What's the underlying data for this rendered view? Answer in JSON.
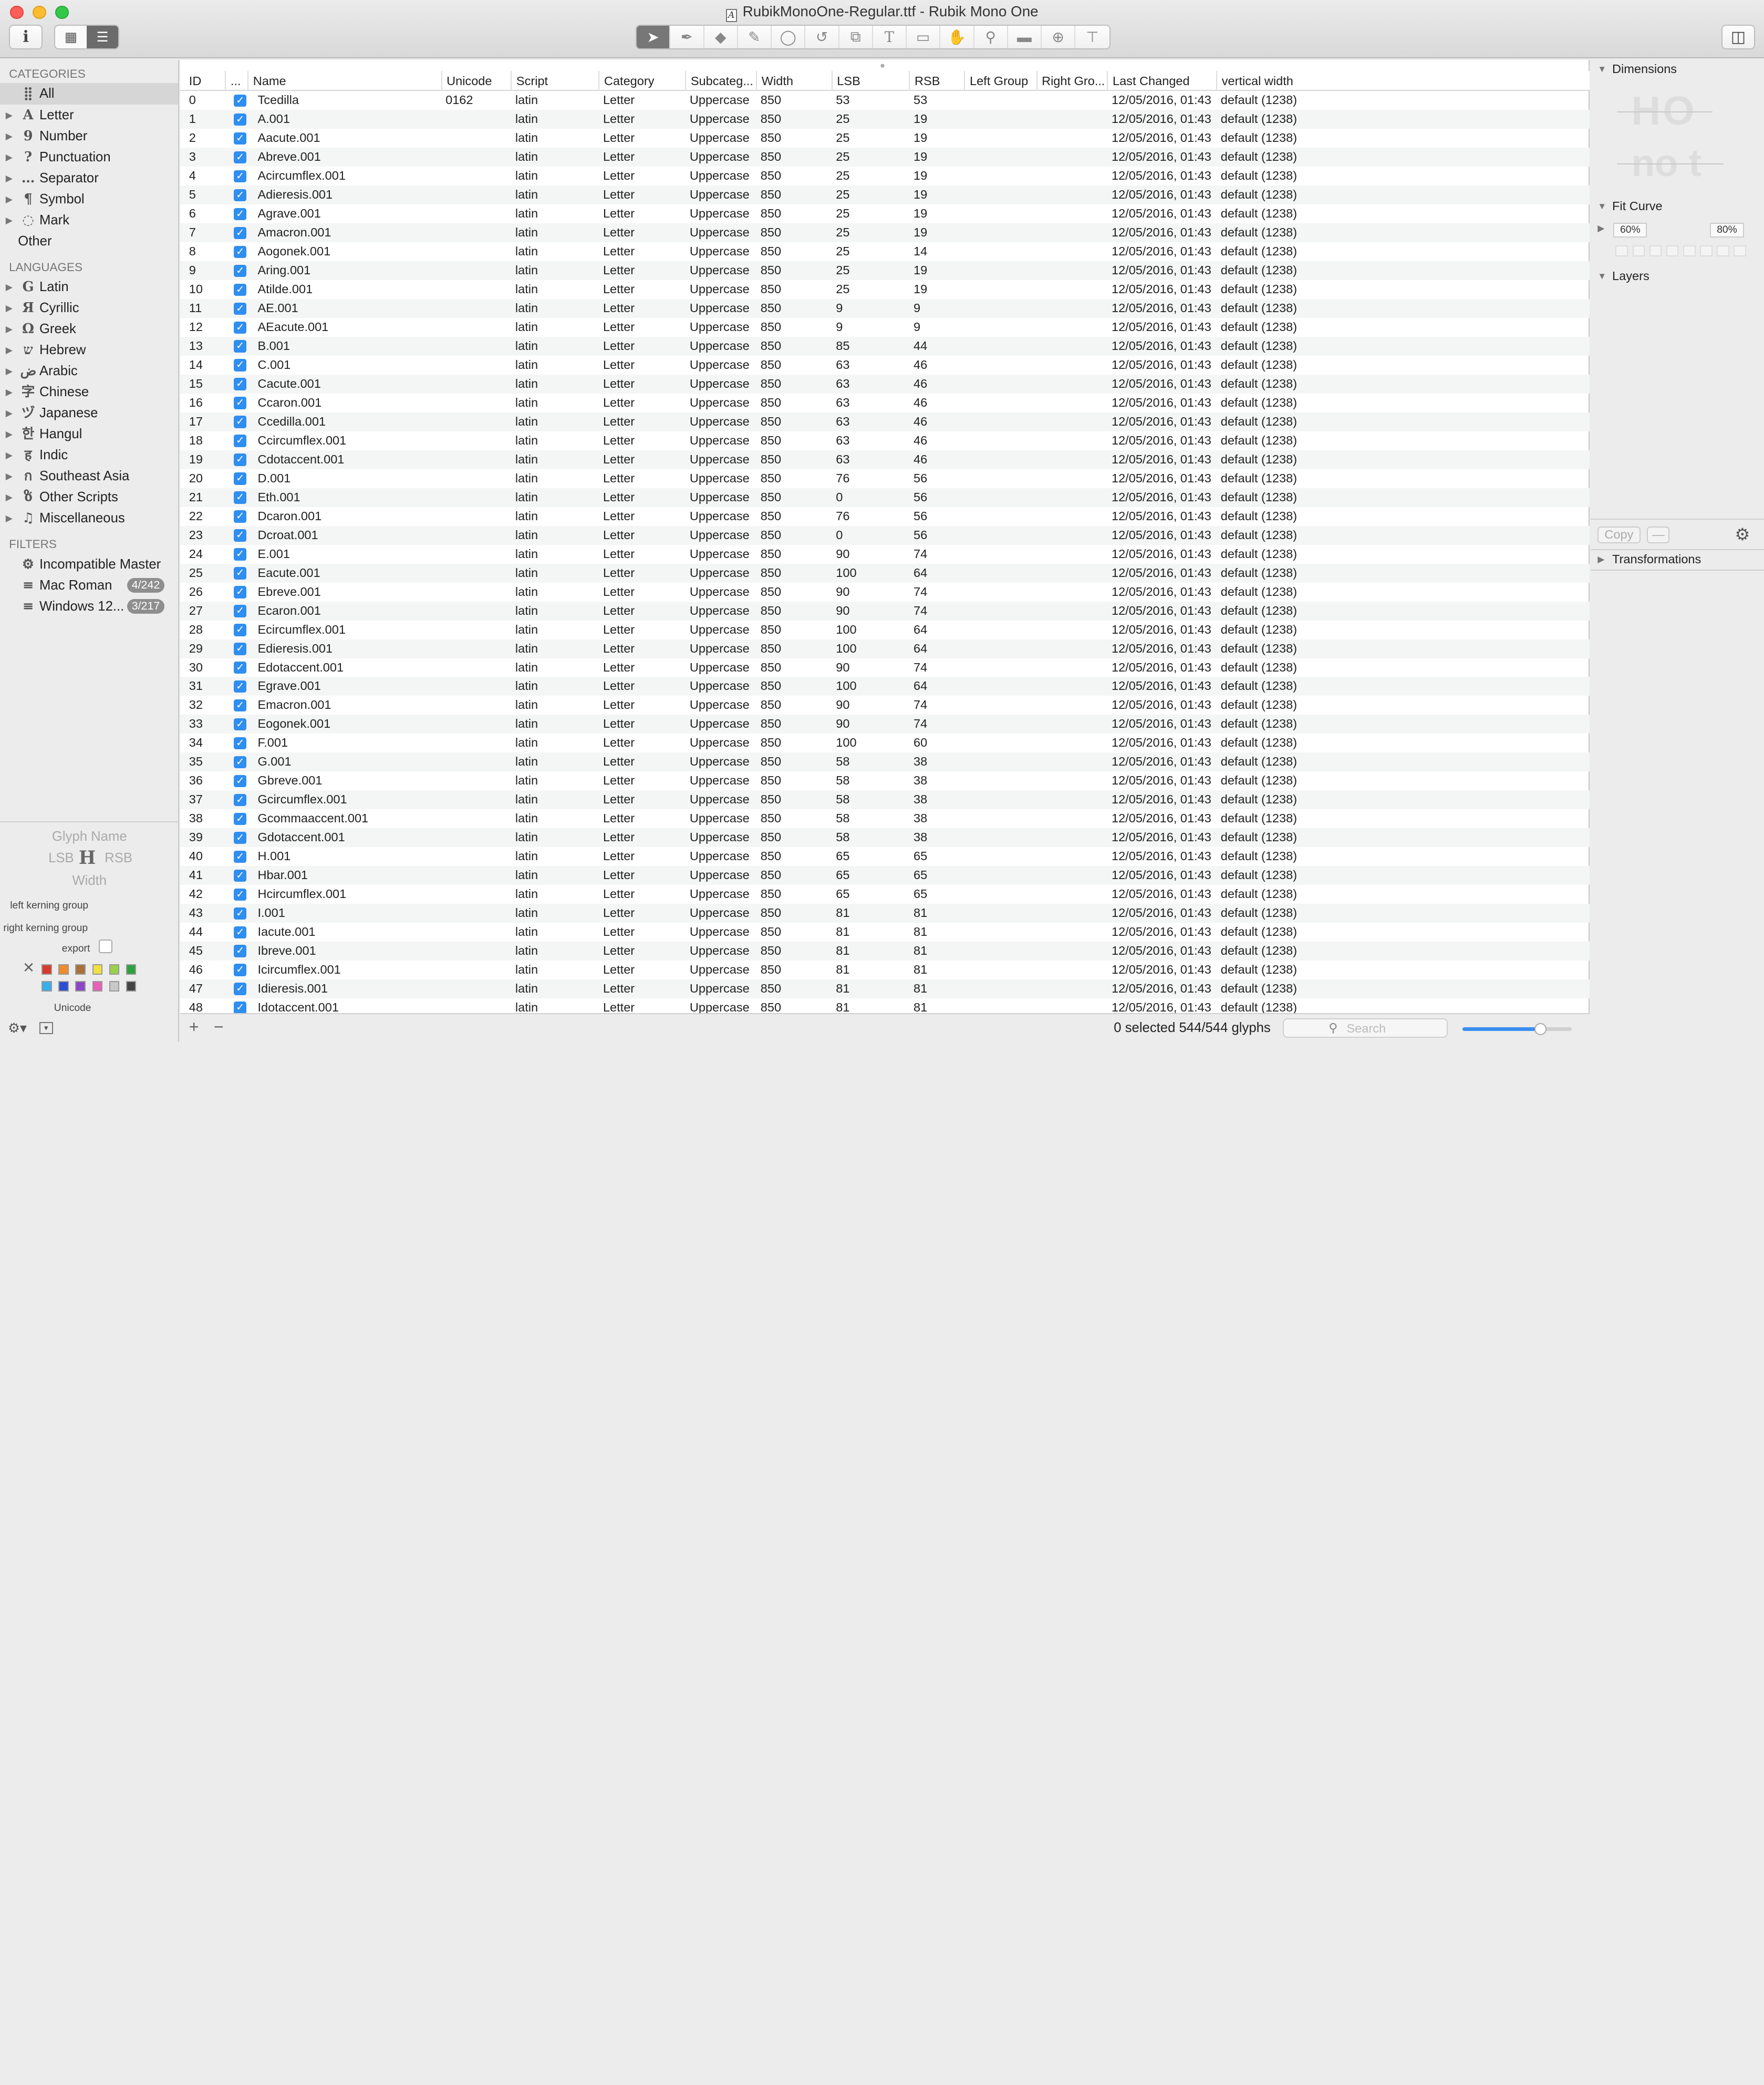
{
  "window": {
    "title": "RubikMonoOne-Regular.ttf - Rubik Mono One",
    "file_icon": "A"
  },
  "toolbar": {
    "info_label": "i",
    "view_grid_icon": "grid-view-icon",
    "view_list_icon": "list-view-icon",
    "tools": [
      "select-tool-icon",
      "select-all-layers-icon",
      "draw-tool-icon",
      "pencil-tool-icon",
      "primitives-tool-icon",
      "rotate-tool-icon",
      "scale-tool-icon",
      "text-tool-icon",
      "annotation-tool-icon",
      "hand-tool-icon",
      "zoom-tool-icon",
      "measurement-tool-icon",
      "knife-tool-icon",
      "anchor-tool-icon"
    ]
  },
  "sidebar": {
    "categories_header": "CATEGORIES",
    "categories": [
      {
        "label": "All",
        "glyph": "⣿",
        "expandable": false,
        "selected": true
      },
      {
        "label": "Letter",
        "glyph": "A",
        "expandable": true
      },
      {
        "label": "Number",
        "glyph": "9",
        "expandable": true
      },
      {
        "label": "Punctuation",
        "glyph": "?",
        "expandable": true
      },
      {
        "label": "Separator",
        "glyph": "…",
        "expandable": true
      },
      {
        "label": "Symbol",
        "glyph": "¶",
        "expandable": true
      },
      {
        "label": "Mark",
        "glyph": "◌",
        "expandable": true
      },
      {
        "label": "Other",
        "glyph": "",
        "expandable": false
      }
    ],
    "languages_header": "LANGUAGES",
    "languages": [
      {
        "label": "Latin",
        "glyph": "G"
      },
      {
        "label": "Cyrillic",
        "glyph": "Я"
      },
      {
        "label": "Greek",
        "glyph": "Ω"
      },
      {
        "label": "Hebrew",
        "glyph": "ש"
      },
      {
        "label": "Arabic",
        "glyph": "ض"
      },
      {
        "label": "Chinese",
        "glyph": "字"
      },
      {
        "label": "Japanese",
        "glyph": "ヅ"
      },
      {
        "label": "Hangul",
        "glyph": "한"
      },
      {
        "label": "Indic",
        "glyph": "ह"
      },
      {
        "label": "Southeast Asia",
        "glyph": "ก"
      },
      {
        "label": "Other Scripts",
        "glyph": "ზ"
      },
      {
        "label": "Miscellaneous",
        "glyph": "♫"
      }
    ],
    "filters_header": "FILTERS",
    "filters": [
      {
        "label": "Incompatible Master",
        "glyph": "⚙",
        "badge": ""
      },
      {
        "label": "Mac Roman",
        "glyph": "≡",
        "badge": "4/242"
      },
      {
        "label": "Windows 12...",
        "glyph": "≡",
        "badge": "3/217"
      }
    ],
    "glyph_info": {
      "name_placeholder": "Glyph Name",
      "lsb": "LSB",
      "rsb": "RSB",
      "width": "Width",
      "left_kerning": "left kerning group",
      "right_kerning": "right kerning group",
      "export_label": "export",
      "unicode_label": "Unicode",
      "colors": [
        "#d93a2e",
        "#f08c2a",
        "#a8713a",
        "#f0e040",
        "#9ad04c",
        "#2ea23c",
        "#3aaee8",
        "#2c4fd0",
        "#8a48c8",
        "#e860b8",
        "#c8c8c8",
        "#444444"
      ]
    }
  },
  "table": {
    "columns": [
      "ID",
      "...",
      "Name",
      "Unicode",
      "Script",
      "Category",
      "Subcateg...",
      "Width",
      "LSB",
      "RSB",
      "Left Group",
      "Right Gro...",
      "Last Changed",
      "vertical width"
    ],
    "rows": [
      [
        "0",
        "Tcedilla",
        "0162",
        "latin",
        "Letter",
        "Uppercase",
        "850",
        "53",
        "53",
        "12/05/2016, 01:43",
        "default (1238)"
      ],
      [
        "1",
        "A.001",
        "",
        "latin",
        "Letter",
        "Uppercase",
        "850",
        "25",
        "19",
        "12/05/2016, 01:43",
        "default (1238)"
      ],
      [
        "2",
        "Aacute.001",
        "",
        "latin",
        "Letter",
        "Uppercase",
        "850",
        "25",
        "19",
        "12/05/2016, 01:43",
        "default (1238)"
      ],
      [
        "3",
        "Abreve.001",
        "",
        "latin",
        "Letter",
        "Uppercase",
        "850",
        "25",
        "19",
        "12/05/2016, 01:43",
        "default (1238)"
      ],
      [
        "4",
        "Acircumflex.001",
        "",
        "latin",
        "Letter",
        "Uppercase",
        "850",
        "25",
        "19",
        "12/05/2016, 01:43",
        "default (1238)"
      ],
      [
        "5",
        "Adieresis.001",
        "",
        "latin",
        "Letter",
        "Uppercase",
        "850",
        "25",
        "19",
        "12/05/2016, 01:43",
        "default (1238)"
      ],
      [
        "6",
        "Agrave.001",
        "",
        "latin",
        "Letter",
        "Uppercase",
        "850",
        "25",
        "19",
        "12/05/2016, 01:43",
        "default (1238)"
      ],
      [
        "7",
        "Amacron.001",
        "",
        "latin",
        "Letter",
        "Uppercase",
        "850",
        "25",
        "19",
        "12/05/2016, 01:43",
        "default (1238)"
      ],
      [
        "8",
        "Aogonek.001",
        "",
        "latin",
        "Letter",
        "Uppercase",
        "850",
        "25",
        "14",
        "12/05/2016, 01:43",
        "default (1238)"
      ],
      [
        "9",
        "Aring.001",
        "",
        "latin",
        "Letter",
        "Uppercase",
        "850",
        "25",
        "19",
        "12/05/2016, 01:43",
        "default (1238)"
      ],
      [
        "10",
        "Atilde.001",
        "",
        "latin",
        "Letter",
        "Uppercase",
        "850",
        "25",
        "19",
        "12/05/2016, 01:43",
        "default (1238)"
      ],
      [
        "11",
        "AE.001",
        "",
        "latin",
        "Letter",
        "Uppercase",
        "850",
        "9",
        "9",
        "12/05/2016, 01:43",
        "default (1238)"
      ],
      [
        "12",
        "AEacute.001",
        "",
        "latin",
        "Letter",
        "Uppercase",
        "850",
        "9",
        "9",
        "12/05/2016, 01:43",
        "default (1238)"
      ],
      [
        "13",
        "B.001",
        "",
        "latin",
        "Letter",
        "Uppercase",
        "850",
        "85",
        "44",
        "12/05/2016, 01:43",
        "default (1238)"
      ],
      [
        "14",
        "C.001",
        "",
        "latin",
        "Letter",
        "Uppercase",
        "850",
        "63",
        "46",
        "12/05/2016, 01:43",
        "default (1238)"
      ],
      [
        "15",
        "Cacute.001",
        "",
        "latin",
        "Letter",
        "Uppercase",
        "850",
        "63",
        "46",
        "12/05/2016, 01:43",
        "default (1238)"
      ],
      [
        "16",
        "Ccaron.001",
        "",
        "latin",
        "Letter",
        "Uppercase",
        "850",
        "63",
        "46",
        "12/05/2016, 01:43",
        "default (1238)"
      ],
      [
        "17",
        "Ccedilla.001",
        "",
        "latin",
        "Letter",
        "Uppercase",
        "850",
        "63",
        "46",
        "12/05/2016, 01:43",
        "default (1238)"
      ],
      [
        "18",
        "Ccircumflex.001",
        "",
        "latin",
        "Letter",
        "Uppercase",
        "850",
        "63",
        "46",
        "12/05/2016, 01:43",
        "default (1238)"
      ],
      [
        "19",
        "Cdotaccent.001",
        "",
        "latin",
        "Letter",
        "Uppercase",
        "850",
        "63",
        "46",
        "12/05/2016, 01:43",
        "default (1238)"
      ],
      [
        "20",
        "D.001",
        "",
        "latin",
        "Letter",
        "Uppercase",
        "850",
        "76",
        "56",
        "12/05/2016, 01:43",
        "default (1238)"
      ],
      [
        "21",
        "Eth.001",
        "",
        "latin",
        "Letter",
        "Uppercase",
        "850",
        "0",
        "56",
        "12/05/2016, 01:43",
        "default (1238)"
      ],
      [
        "22",
        "Dcaron.001",
        "",
        "latin",
        "Letter",
        "Uppercase",
        "850",
        "76",
        "56",
        "12/05/2016, 01:43",
        "default (1238)"
      ],
      [
        "23",
        "Dcroat.001",
        "",
        "latin",
        "Letter",
        "Uppercase",
        "850",
        "0",
        "56",
        "12/05/2016, 01:43",
        "default (1238)"
      ],
      [
        "24",
        "E.001",
        "",
        "latin",
        "Letter",
        "Uppercase",
        "850",
        "90",
        "74",
        "12/05/2016, 01:43",
        "default (1238)"
      ],
      [
        "25",
        "Eacute.001",
        "",
        "latin",
        "Letter",
        "Uppercase",
        "850",
        "100",
        "64",
        "12/05/2016, 01:43",
        "default (1238)"
      ],
      [
        "26",
        "Ebreve.001",
        "",
        "latin",
        "Letter",
        "Uppercase",
        "850",
        "90",
        "74",
        "12/05/2016, 01:43",
        "default (1238)"
      ],
      [
        "27",
        "Ecaron.001",
        "",
        "latin",
        "Letter",
        "Uppercase",
        "850",
        "90",
        "74",
        "12/05/2016, 01:43",
        "default (1238)"
      ],
      [
        "28",
        "Ecircumflex.001",
        "",
        "latin",
        "Letter",
        "Uppercase",
        "850",
        "100",
        "64",
        "12/05/2016, 01:43",
        "default (1238)"
      ],
      [
        "29",
        "Edieresis.001",
        "",
        "latin",
        "Letter",
        "Uppercase",
        "850",
        "100",
        "64",
        "12/05/2016, 01:43",
        "default (1238)"
      ],
      [
        "30",
        "Edotaccent.001",
        "",
        "latin",
        "Letter",
        "Uppercase",
        "850",
        "90",
        "74",
        "12/05/2016, 01:43",
        "default (1238)"
      ],
      [
        "31",
        "Egrave.001",
        "",
        "latin",
        "Letter",
        "Uppercase",
        "850",
        "100",
        "64",
        "12/05/2016, 01:43",
        "default (1238)"
      ],
      [
        "32",
        "Emacron.001",
        "",
        "latin",
        "Letter",
        "Uppercase",
        "850",
        "90",
        "74",
        "12/05/2016, 01:43",
        "default (1238)"
      ],
      [
        "33",
        "Eogonek.001",
        "",
        "latin",
        "Letter",
        "Uppercase",
        "850",
        "90",
        "74",
        "12/05/2016, 01:43",
        "default (1238)"
      ],
      [
        "34",
        "F.001",
        "",
        "latin",
        "Letter",
        "Uppercase",
        "850",
        "100",
        "60",
        "12/05/2016, 01:43",
        "default (1238)"
      ],
      [
        "35",
        "G.001",
        "",
        "latin",
        "Letter",
        "Uppercase",
        "850",
        "58",
        "38",
        "12/05/2016, 01:43",
        "default (1238)"
      ],
      [
        "36",
        "Gbreve.001",
        "",
        "latin",
        "Letter",
        "Uppercase",
        "850",
        "58",
        "38",
        "12/05/2016, 01:43",
        "default (1238)"
      ],
      [
        "37",
        "Gcircumflex.001",
        "",
        "latin",
        "Letter",
        "Uppercase",
        "850",
        "58",
        "38",
        "12/05/2016, 01:43",
        "default (1238)"
      ],
      [
        "38",
        "Gcommaaccent.001",
        "",
        "latin",
        "Letter",
        "Uppercase",
        "850",
        "58",
        "38",
        "12/05/2016, 01:43",
        "default (1238)"
      ],
      [
        "39",
        "Gdotaccent.001",
        "",
        "latin",
        "Letter",
        "Uppercase",
        "850",
        "58",
        "38",
        "12/05/2016, 01:43",
        "default (1238)"
      ],
      [
        "40",
        "H.001",
        "",
        "latin",
        "Letter",
        "Uppercase",
        "850",
        "65",
        "65",
        "12/05/2016, 01:43",
        "default (1238)"
      ],
      [
        "41",
        "Hbar.001",
        "",
        "latin",
        "Letter",
        "Uppercase",
        "850",
        "65",
        "65",
        "12/05/2016, 01:43",
        "default (1238)"
      ],
      [
        "42",
        "Hcircumflex.001",
        "",
        "latin",
        "Letter",
        "Uppercase",
        "850",
        "65",
        "65",
        "12/05/2016, 01:43",
        "default (1238)"
      ],
      [
        "43",
        "I.001",
        "",
        "latin",
        "Letter",
        "Uppercase",
        "850",
        "81",
        "81",
        "12/05/2016, 01:43",
        "default (1238)"
      ],
      [
        "44",
        "Iacute.001",
        "",
        "latin",
        "Letter",
        "Uppercase",
        "850",
        "81",
        "81",
        "12/05/2016, 01:43",
        "default (1238)"
      ],
      [
        "45",
        "Ibreve.001",
        "",
        "latin",
        "Letter",
        "Uppercase",
        "850",
        "81",
        "81",
        "12/05/2016, 01:43",
        "default (1238)"
      ],
      [
        "46",
        "Icircumflex.001",
        "",
        "latin",
        "Letter",
        "Uppercase",
        "850",
        "81",
        "81",
        "12/05/2016, 01:43",
        "default (1238)"
      ],
      [
        "47",
        "Idieresis.001",
        "",
        "latin",
        "Letter",
        "Uppercase",
        "850",
        "81",
        "81",
        "12/05/2016, 01:43",
        "default (1238)"
      ],
      [
        "48",
        "Idotaccent.001",
        "",
        "latin",
        "Letter",
        "Uppercase",
        "850",
        "81",
        "81",
        "12/05/2016, 01:43",
        "default (1238)"
      ]
    ],
    "footer": {
      "status": "0 selected 544/544 glyphs",
      "search_placeholder": "Search",
      "zoom_level": 0.72
    }
  },
  "right_panel": {
    "dimensions_label": "Dimensions",
    "dim_preview_top": "HO",
    "dim_preview_bottom": "no t",
    "fit_curve_label": "Fit Curve",
    "fit_curve_min": "60%",
    "fit_curve_max": "80%",
    "layers_label": "Layers",
    "copy_label": "Copy",
    "transformations_label": "Transformations"
  }
}
